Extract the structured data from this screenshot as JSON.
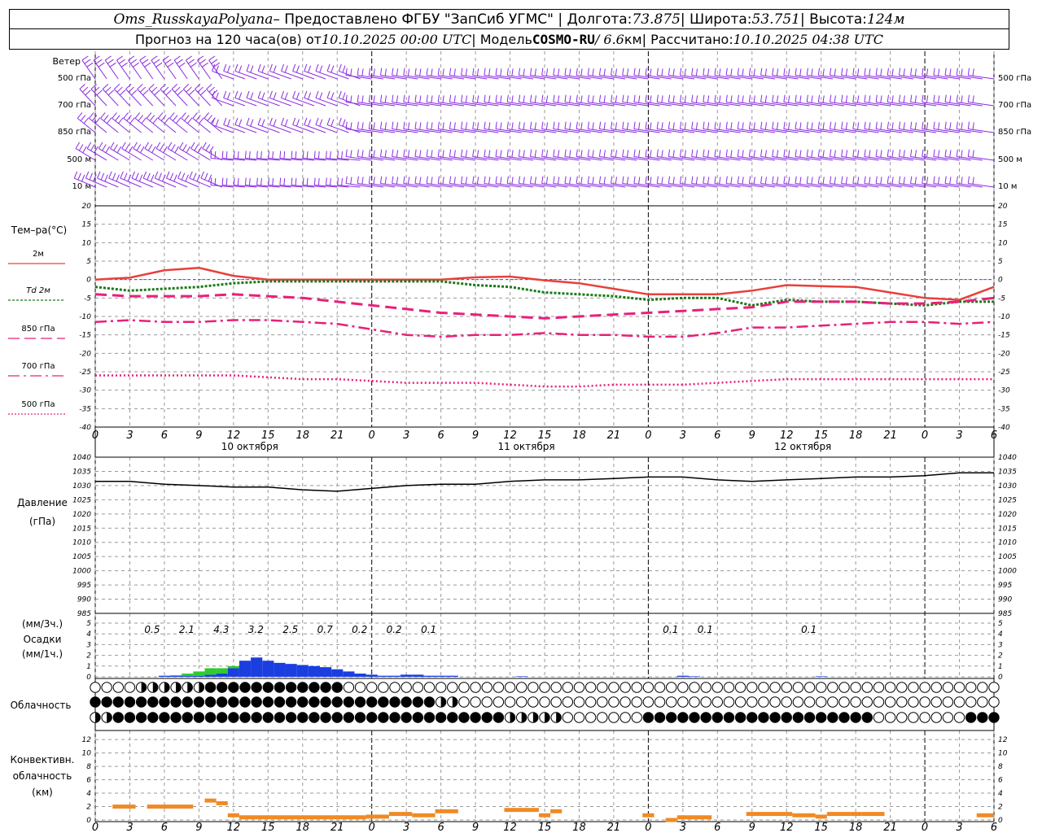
{
  "header": {
    "station": "Oms_RusskayaPolyana",
    "provided_prefix": " – Предоставлено ФГБУ \"ЗапСиб УГМС\" | Долгота: ",
    "lon": "73.875",
    "lat_label": " | Широта: ",
    "lat": "53.751",
    "height_label": " | Высота: ",
    "height": "124м",
    "forecast_prefix": "Прогноз на 120 часа(ов) от ",
    "forecast_start": "10.10.2025 00:00 UTC",
    "model_label": " | Модель ",
    "model": "COSMO-RU",
    "model_res": " / 6.6",
    "model_res_unit": "км",
    "computed_label": " | Рассчитано: ",
    "computed": "10.10.2025 04:38 UTC"
  },
  "wind": {
    "title": "Ветер",
    "levels": [
      "500 гПа",
      "700 гПа",
      "850 гПа",
      "500 м",
      "10 м"
    ],
    "color": "#8a2be2"
  },
  "temp": {
    "title": "Тем–ра(°C)",
    "ticks": [
      20,
      15,
      10,
      5,
      0,
      -5,
      -10,
      -15,
      -20,
      -25,
      -30,
      -35,
      -40
    ],
    "legend": [
      {
        "label": "2м",
        "color": "#e8403c",
        "style": "solid"
      },
      {
        "label": "Td  2м",
        "color": "#1a7a1a",
        "style": "dotted"
      },
      {
        "label": "850 гПа",
        "color": "#e8207a",
        "style": "dash"
      },
      {
        "label": "700 гПа",
        "color": "#e8207a",
        "style": "dashdot"
      },
      {
        "label": "500 гПа",
        "color": "#e8207a",
        "style": "dot"
      }
    ]
  },
  "x_hour_labels": [
    "0",
    "3",
    "6",
    "9",
    "12",
    "15",
    "18",
    "21",
    "0",
    "3",
    "6",
    "9",
    "12",
    "15",
    "18",
    "21",
    "0",
    "3",
    "6",
    "9",
    "12",
    "15",
    "18",
    "21",
    "0",
    "3",
    "6"
  ],
  "day_labels": [
    "10 октября",
    "11 октября",
    "12 октября"
  ],
  "pressure": {
    "title_line1": "Давление",
    "title_line2": "(гПа)",
    "ticks": [
      1040,
      1035,
      1030,
      1025,
      1020,
      1015,
      1010,
      1005,
      1000,
      995,
      990,
      985
    ]
  },
  "precip": {
    "title_3h": "(мм/3ч.)",
    "title": "Осадки",
    "title_1h": "(мм/1ч.)",
    "ticks": [
      5,
      4,
      3,
      2,
      1,
      0
    ],
    "totals_3h": [
      {
        "hour": 6,
        "value": "0.5"
      },
      {
        "hour": 9,
        "value": "2.1"
      },
      {
        "hour": 12,
        "value": "4.3"
      },
      {
        "hour": 15,
        "value": "3.2"
      },
      {
        "hour": 18,
        "value": "2.5"
      },
      {
        "hour": 21,
        "value": "0.7"
      },
      {
        "hour": 24,
        "value": "0.2"
      },
      {
        "hour": 27,
        "value": "0.2"
      },
      {
        "hour": 30,
        "value": "0.1"
      },
      {
        "hour": 51,
        "value": "0.1"
      },
      {
        "hour": 54,
        "value": "0.1"
      },
      {
        "hour": 63,
        "value": "0.1"
      }
    ]
  },
  "cloud": {
    "title": "Облачность"
  },
  "conv": {
    "title_line1": "Конвективн.",
    "title_line2": "облачность",
    "title_line3": "(км)",
    "ticks": [
      12,
      10,
      8,
      6,
      4,
      2,
      0
    ],
    "color": "#f08a24"
  },
  "chart_data": [
    {
      "type": "line",
      "title": "Тем–ра(°C)",
      "x_hours": [
        0,
        3,
        6,
        9,
        12,
        15,
        18,
        21,
        24,
        27,
        30,
        33,
        36,
        39,
        42,
        45,
        48,
        51,
        54,
        57,
        60,
        63,
        66,
        69,
        72,
        75,
        78
      ],
      "ylim": [
        -40,
        20
      ],
      "series": [
        {
          "name": "2м",
          "values": [
            0,
            0.5,
            2.5,
            3.2,
            1,
            0,
            0,
            0,
            0,
            0,
            0,
            0.6,
            0.8,
            -0.2,
            -1,
            -2.5,
            -4,
            -4,
            -4,
            -3,
            -1.5,
            -1.8,
            -2,
            -3.5,
            -5,
            -5.5,
            -2
          ]
        },
        {
          "name": "Td  2м",
          "values": [
            -2,
            -3,
            -2.5,
            -2,
            -1,
            -0.5,
            -0.5,
            -0.5,
            -0.5,
            -0.5,
            -0.5,
            -1.5,
            -2,
            -3.5,
            -4,
            -4.5,
            -5.5,
            -5,
            -5,
            -7,
            -5.5,
            -6,
            -6,
            -6.5,
            -7,
            -6,
            -6
          ]
        },
        {
          "name": "850 гПа",
          "values": [
            -4,
            -4.5,
            -4.5,
            -4.5,
            -4,
            -4.5,
            -5,
            -6,
            -7,
            -8,
            -9,
            -9.5,
            -10,
            -10.5,
            -10,
            -9.5,
            -9,
            -8.5,
            -8,
            -7.5,
            -6,
            -6,
            -6,
            -6.5,
            -6.5,
            -6,
            -5
          ]
        },
        {
          "name": "700 гПа",
          "values": [
            -11.5,
            -11,
            -11.5,
            -11.5,
            -11,
            -11,
            -11.5,
            -12,
            -13.5,
            -15,
            -15.5,
            -15,
            -15,
            -14.5,
            -15,
            -15,
            -15.5,
            -15.5,
            -14.5,
            -13,
            -13,
            -12.5,
            -12,
            -11.5,
            -11.5,
            -12,
            -11.5
          ]
        },
        {
          "name": "500 гПа",
          "values": [
            -26,
            -26,
            -26,
            -26,
            -26,
            -26.5,
            -27,
            -27,
            -27.5,
            -28,
            -28,
            -28,
            -28.5,
            -29,
            -29,
            -28.5,
            -28.5,
            -28.5,
            -28,
            -27.5,
            -27,
            -27,
            -27,
            -27,
            -27,
            -27,
            -27
          ]
        }
      ]
    },
    {
      "type": "line",
      "title": "Давление (гПа)",
      "x_hours": [
        0,
        3,
        6,
        9,
        12,
        15,
        18,
        21,
        24,
        27,
        30,
        33,
        36,
        39,
        42,
        45,
        48,
        51,
        54,
        57,
        60,
        63,
        66,
        69,
        72,
        75,
        78
      ],
      "ylim": [
        985,
        1040
      ],
      "series": [
        {
          "name": "",
          "values": [
            1031.5,
            1031.5,
            1030.5,
            1030,
            1029.5,
            1029.5,
            1028.5,
            1028,
            1029,
            1030,
            1030.5,
            1030.5,
            1031.5,
            1032,
            1032,
            1032.5,
            1033,
            1033,
            1032,
            1031.5,
            1032,
            1032.5,
            1033,
            1033,
            1033.5,
            1034.5,
            1034.5
          ]
        }
      ]
    },
    {
      "type": "bar",
      "title": "Осадки",
      "x_hours": [
        0,
        1,
        2,
        3,
        4,
        5,
        6,
        7,
        8,
        9,
        10,
        11,
        12,
        13,
        14,
        15,
        16,
        17,
        18,
        19,
        20,
        21,
        22,
        23,
        24,
        25,
        26,
        27,
        28,
        29,
        30,
        31,
        32,
        33,
        34,
        35,
        36,
        37,
        38,
        39,
        40,
        41,
        42,
        43,
        44,
        45,
        46,
        47,
        48,
        49,
        50,
        51,
        52,
        53,
        54,
        55,
        56,
        57,
        58,
        59,
        60,
        61,
        62,
        63,
        64,
        65,
        66,
        67,
        68,
        69,
        70,
        71,
        72,
        73,
        74,
        75,
        76,
        77,
        78
      ],
      "ylim": [
        0,
        5
      ],
      "series": [
        {
          "name": "snow",
          "color": "#1b3ee0",
          "values": [
            0,
            0,
            0,
            0,
            0,
            0,
            0.1,
            0.1,
            0.1,
            0.1,
            0.2,
            0.3,
            0.8,
            1.5,
            1.8,
            1.5,
            1.3,
            1.2,
            1.1,
            1.0,
            0.9,
            0.7,
            0.5,
            0.3,
            0.2,
            0.1,
            0.1,
            0.2,
            0.2,
            0.1,
            0.1,
            0.1,
            0,
            0,
            0,
            0,
            0,
            0.05,
            0,
            0,
            0,
            0,
            0,
            0,
            0,
            0,
            0,
            0,
            0,
            0,
            0,
            0.1,
            0.05,
            0,
            0,
            0,
            0,
            0,
            0,
            0,
            0,
            0,
            0,
            0.05,
            0,
            0,
            0,
            0,
            0,
            0,
            0,
            0,
            0,
            0,
            0,
            0,
            0,
            0,
            0
          ]
        },
        {
          "name": "rain",
          "color": "#2ecc2e",
          "values": [
            0,
            0,
            0,
            0,
            0,
            0,
            0,
            0.05,
            0.2,
            0.4,
            0.6,
            0.5,
            0.2,
            0,
            0,
            0,
            0,
            0,
            0,
            0,
            0,
            0,
            0,
            0,
            0,
            0,
            0,
            0,
            0,
            0,
            0,
            0,
            0,
            0,
            0,
            0,
            0,
            0,
            0,
            0,
            0,
            0,
            0,
            0,
            0,
            0,
            0,
            0,
            0,
            0,
            0,
            0,
            0,
            0,
            0,
            0,
            0,
            0,
            0,
            0,
            0,
            0,
            0,
            0,
            0,
            0,
            0,
            0,
            0,
            0,
            0,
            0,
            0,
            0,
            0,
            0,
            0,
            0,
            0
          ]
        }
      ]
    },
    {
      "type": "bar",
      "title": "Конвективн. облачность (км)",
      "ylim": [
        0,
        13
      ],
      "segments": [
        {
          "from": 1.5,
          "to": 3.5,
          "top": 2.3
        },
        {
          "from": 4.5,
          "to": 8.5,
          "top": 2.3
        },
        {
          "from": 9.5,
          "to": 10.5,
          "top": 3.2
        },
        {
          "from": 10.5,
          "to": 11.5,
          "top": 2.8
        },
        {
          "from": 11.5,
          "to": 12.5,
          "top": 1.0
        },
        {
          "from": 12.5,
          "to": 23.5,
          "top": 0.7
        },
        {
          "from": 23.5,
          "to": 25.5,
          "top": 0.8
        },
        {
          "from": 25.5,
          "to": 27.5,
          "top": 1.2
        },
        {
          "from": 27.5,
          "to": 29.5,
          "top": 1.0
        },
        {
          "from": 29.5,
          "to": 31.5,
          "top": 1.6
        },
        {
          "from": 35.5,
          "to": 38.5,
          "top": 1.8
        },
        {
          "from": 38.5,
          "to": 39.5,
          "top": 1.0
        },
        {
          "from": 39.5,
          "to": 40.5,
          "top": 1.6
        },
        {
          "from": 47.5,
          "to": 48.5,
          "top": 1.0
        },
        {
          "from": 49.5,
          "to": 50.5,
          "top": 0.3
        },
        {
          "from": 50.5,
          "to": 53.5,
          "top": 0.7
        },
        {
          "from": 56.5,
          "to": 60.5,
          "top": 1.2
        },
        {
          "from": 60.5,
          "to": 62.5,
          "top": 1.0
        },
        {
          "from": 62.5,
          "to": 63.5,
          "top": 0.8
        },
        {
          "from": 63.5,
          "to": 65.5,
          "top": 1.2
        },
        {
          "from": 65.5,
          "to": 66.5,
          "top": 1.2
        },
        {
          "from": 66.5,
          "to": 68.5,
          "top": 1.2
        },
        {
          "from": 76.5,
          "to": 78,
          "top": 1.0
        }
      ]
    }
  ]
}
